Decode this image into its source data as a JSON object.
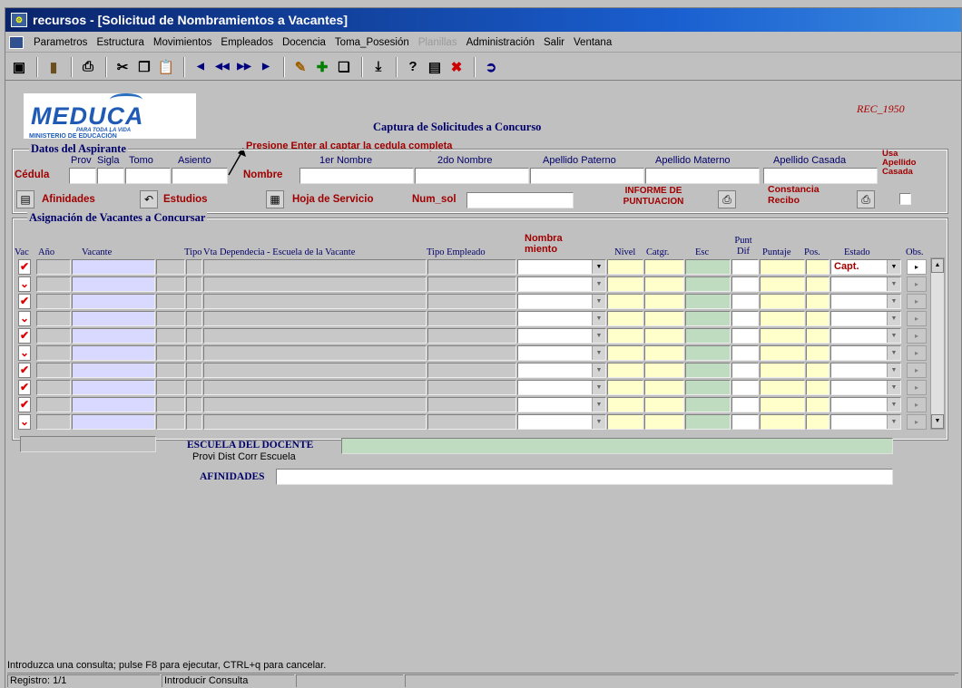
{
  "window": {
    "title": "recursos - [Solicitud de Nombramientos a Vacantes]"
  },
  "menu": [
    "Parametros",
    "Estructura",
    "Movimientos",
    "Empleados",
    "Docencia",
    "Toma_Posesión",
    "Planillas",
    "Administración",
    "Salir",
    "Ventana"
  ],
  "menu_disabled": [
    "Planillas"
  ],
  "toolbar": {
    "icons": [
      "save-icon",
      "exit-icon",
      "print-icon",
      "cut-icon",
      "copy-icon",
      "paste-icon",
      "first-record-icon",
      "previous-set-icon",
      "next-set-icon",
      "last-record-icon",
      "edit-icon",
      "insert-record-icon",
      "duplicate-record-icon",
      "download-icon",
      "query-icon",
      "execute-query-icon",
      "cancel-query-icon",
      "help-icon"
    ]
  },
  "header": {
    "logo_text": "MEDUCA",
    "logo_tagline": "PARA TODA LA VIDA",
    "logo_ministry": "MINISTERIO DE EDUCACIÓN",
    "screen_code": "REC_1950",
    "form_title": "Captura de Solicitudes a Concurso",
    "hint": "Presione Enter al captar la cedula completa"
  },
  "aspirante": {
    "legend": "Datos del Aspirante",
    "cedula_label": "Cédula",
    "cols": {
      "prov": "Prov",
      "sigla": "Sigla",
      "tomo": "Tomo",
      "asiento": "Asiento"
    },
    "nombre_label": "Nombre",
    "name_cols": {
      "n1": "1er Nombre",
      "n2": "2do Nombre",
      "ap": "Apellido Paterno",
      "am": "Apellido Materno",
      "ac": "Apellido Casada"
    },
    "usa_apellido": "Usa Apellido Casada",
    "afinidades_btn": "Afinidades",
    "estudios_btn": "Estudios",
    "hoja_servicio": "Hoja de Servicio",
    "num_sol": "Num_sol",
    "informe": "INFORME DE PUNTUACION",
    "constancia": "Constancia Recibo"
  },
  "vacantes": {
    "legend": "Asignación de Vacantes a Concursar",
    "headers": {
      "vac": "Vac",
      "anio": "Año",
      "vacante": "Vacante",
      "tipo": "Tipo",
      "vta": "Vta",
      "dependencia": "Dependecia - Escuela de la Vacante",
      "tipo_empleado": "Tipo Empleado",
      "nombramiento": "Nombra miento",
      "nivel": "Nivel",
      "catgr": "Catgr.",
      "esc": "Esc",
      "punt_dif": "Punt Dif",
      "puntaje": "Puntaje",
      "pos": "Pos.",
      "estado": "Estado",
      "obs": "Obs."
    },
    "row_count": 10,
    "first_row_estado": "Capt."
  },
  "footer": {
    "escuela_docente": "ESCUELA DEL DOCENTE",
    "escuela_sub": "Provi Dist Corr Escuela",
    "afinidades": "AFINIDADES"
  },
  "status": {
    "message": "Introduzca una consulta;  pulse F8 para ejecutar, CTRL+q  para cancelar.",
    "registro": "Registro: 1/1",
    "mode": "Introducir Consulta"
  }
}
